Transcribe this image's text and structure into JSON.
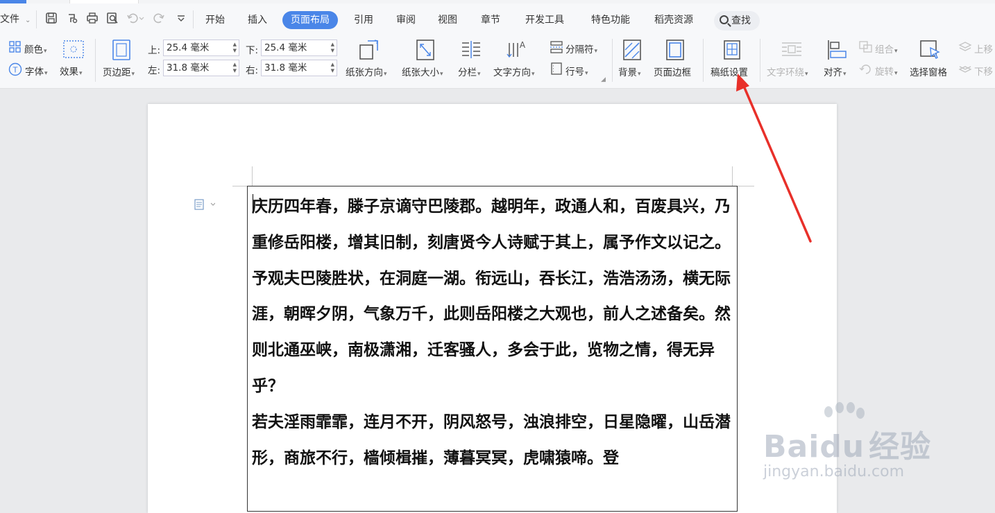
{
  "menu": {
    "file_label": "文件",
    "tabs": [
      {
        "label": "开始",
        "active": false
      },
      {
        "label": "插入",
        "active": false
      },
      {
        "label": "页面布局",
        "active": true
      },
      {
        "label": "引用",
        "active": false
      },
      {
        "label": "审阅",
        "active": false
      },
      {
        "label": "视图",
        "active": false
      },
      {
        "label": "章节",
        "active": false
      },
      {
        "label": "开发工具",
        "active": false
      },
      {
        "label": "特色功能",
        "active": false
      },
      {
        "label": "稻壳资源",
        "active": false
      }
    ],
    "search_label": "查找"
  },
  "ribbon": {
    "color": "颜色",
    "font": "字体",
    "effect": "效果",
    "margin": "页边距",
    "top_label": "上:",
    "top_value": "25.4 毫米",
    "bottom_label": "下:",
    "bottom_value": "25.4 毫米",
    "left_label": "左:",
    "left_value": "31.8 毫米",
    "right_label": "右:",
    "right_value": "31.8 毫米",
    "orientation": "纸张方向",
    "size": "纸张大小",
    "columns": "分栏",
    "text_direction": "文字方向",
    "separator": "分隔符",
    "line_number": "行号",
    "background": "背景",
    "page_border": "页面边框",
    "manuscript": "稿纸设置",
    "text_wrap": "文字环绕",
    "align": "对齐",
    "group": "组合",
    "rotate": "旋转",
    "selection_pane": "选择窗格",
    "bring_forward": "上移",
    "send_backward": "下移"
  },
  "document": {
    "paragraphs": [
      "庆历四年春，滕子京谪守巴陵郡。越明年，政通人和，百废具兴，乃重修岳阳楼，增其旧制，刻唐贤今人诗赋于其上，属予作文以记之。",
      "予观夫巴陵胜状，在洞庭一湖。衔远山，吞长江，浩浩汤汤，横无际涯，朝晖夕阴，气象万千，此则岳阳楼之大观也，前人之述备矣。然则北通巫峡，南极潇湘，迁客骚人，多会于此，览物之情，得无异乎？",
      "若夫淫雨霏霏，连月不开，阴风怒号，浊浪排空，日星隐曜，山岳潜形，商旅不行，樯倾楫摧，薄暮冥冥，虎啸猿啼。登"
    ]
  },
  "watermark": {
    "brand_latin": "Bai",
    "brand_latin2": "du",
    "brand_cn": "经验",
    "url": "jingyan.baidu.com"
  },
  "colors": {
    "accent": "#4a86e8",
    "annotation_arrow": "#e8302a"
  }
}
